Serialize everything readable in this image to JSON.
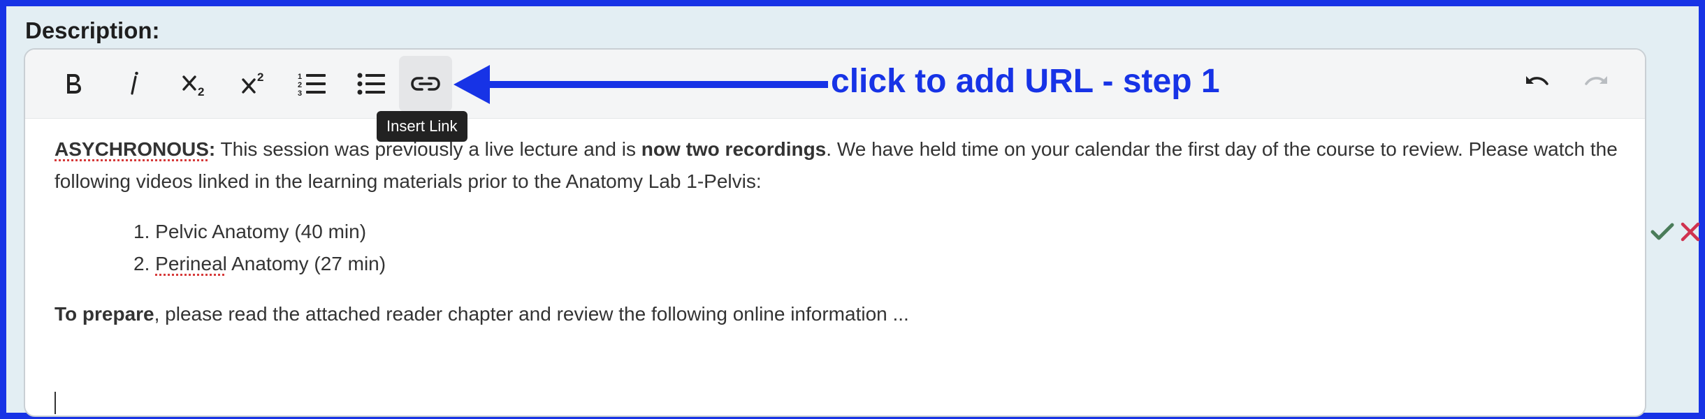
{
  "field": {
    "label": "Description:"
  },
  "toolbar": {
    "buttons": [
      {
        "name": "bold-button",
        "icon": "bold-icon"
      },
      {
        "name": "italic-button",
        "icon": "italic-icon"
      },
      {
        "name": "subscript-button",
        "icon": "subscript-icon"
      },
      {
        "name": "superscript-button",
        "icon": "superscript-icon"
      },
      {
        "name": "ordered-list-button",
        "icon": "ordered-list-icon"
      },
      {
        "name": "bulleted-list-button",
        "icon": "bulleted-list-icon"
      },
      {
        "name": "insert-link-button",
        "icon": "link-icon",
        "active": true
      }
    ],
    "undo_icon": "undo-icon",
    "redo_icon": "redo-icon",
    "tooltip": "Insert Link"
  },
  "annotation": {
    "text": "click to add URL - step 1",
    "color": "#1733e6"
  },
  "content": {
    "p1_bold_label": "ASYCHRONOUS",
    "p1_colon": ":",
    "p1_text_a": " This session was previously a live lecture and is ",
    "p1_bold_mid": "now two recordings",
    "p1_text_b": ".  We have held time on your calendar the first day of the course to review.  Please watch the following videos linked in the learning materials prior to the Anatomy Lab 1-Pelvis:",
    "list": [
      {
        "number": "1.",
        "text_a": "Pelvic Anatomy (40 min)",
        "misspelled": "",
        "text_b": ""
      },
      {
        "number": "2.",
        "text_a": "",
        "misspelled": "Perineal",
        "text_b": " Anatomy (27 min)"
      }
    ],
    "p2_bold": "To prepare",
    "p2_text": ", please read the attached reader chapter and review the following online information ..."
  },
  "actions": {
    "confirm_icon": "checkmark-icon",
    "cancel_icon": "close-icon",
    "confirm_color": "#4a7c59",
    "cancel_color": "#d0324f"
  },
  "colors": {
    "frame_border": "#1733e6",
    "background": "#e3eef3"
  }
}
